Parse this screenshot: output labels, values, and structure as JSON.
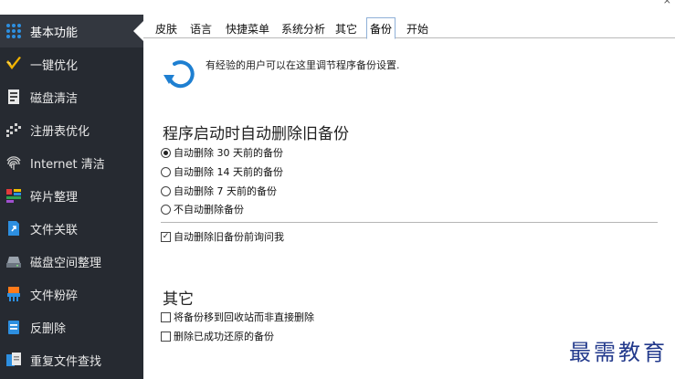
{
  "sidebar": {
    "items": [
      {
        "label": "基本功能",
        "icon": "grid-dots-icon",
        "active": true
      },
      {
        "label": "一键优化",
        "icon": "broom-icon"
      },
      {
        "label": "磁盘清洁",
        "icon": "disk-clean-icon"
      },
      {
        "label": "注册表优化",
        "icon": "registry-icon"
      },
      {
        "label": "Internet 清洁",
        "icon": "fingerprint-icon"
      },
      {
        "label": "碎片整理",
        "icon": "defrag-icon"
      },
      {
        "label": "文件关联",
        "icon": "file-link-icon"
      },
      {
        "label": "磁盘空间整理",
        "icon": "drive-icon"
      },
      {
        "label": "文件粉碎",
        "icon": "shredder-icon"
      },
      {
        "label": "反删除",
        "icon": "undelete-icon"
      },
      {
        "label": "重复文件查找",
        "icon": "duplicate-file-icon"
      }
    ]
  },
  "tabs": [
    {
      "label": "皮肤"
    },
    {
      "label": "语言"
    },
    {
      "label": "快捷菜单"
    },
    {
      "label": "系统分析"
    },
    {
      "label": "其它"
    },
    {
      "label": "备份",
      "active": true
    },
    {
      "label": "开始"
    }
  ],
  "info": {
    "text": "有经验的用户可以在这里调节程序备份设置."
  },
  "auto_delete": {
    "title": "程序启动时自动删除旧备份",
    "options": [
      {
        "label": "自动删除 30 天前的备份",
        "selected": true
      },
      {
        "label": "自动删除 14 天前的备份",
        "selected": false
      },
      {
        "label": "自动删除 7 天前的备份",
        "selected": false
      },
      {
        "label": "不自动删除备份",
        "selected": false
      }
    ],
    "ask_before": {
      "label": "自动删除旧备份前询问我",
      "checked": true
    }
  },
  "other": {
    "title": "其它",
    "move_to_recycle": {
      "label": "将备份移到回收站而非直接删除",
      "checked": false
    },
    "delete_restored": {
      "label": "删除已成功还原的备份",
      "checked": false
    }
  },
  "watermark": "最需教育",
  "colors": {
    "sidebar_bg": "#262a31",
    "accent": "#1e7fd1",
    "watermark": "#233a8c"
  }
}
